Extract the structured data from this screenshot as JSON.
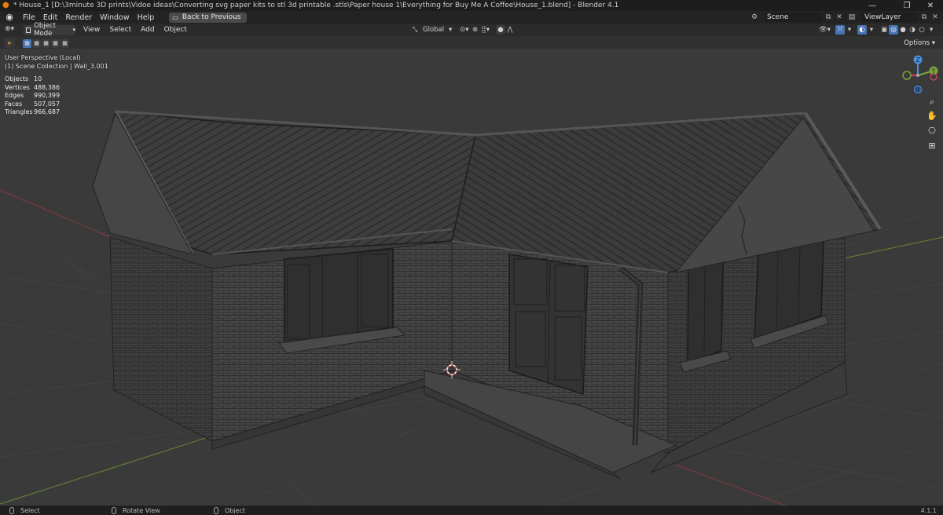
{
  "window": {
    "title": "* House_1 [D:\\3minute 3D prints\\Vidoe ideas\\Converting svg paper kits to stl 3d printable .stls\\Paper house 1\\Everything for Buy Me A Coffee\\House_1.blend] - Blender 4.1",
    "controls": {
      "minimize": "—",
      "maximize": "❐",
      "close": "✕"
    }
  },
  "menubar": {
    "items": [
      "File",
      "Edit",
      "Render",
      "Window",
      "Help"
    ],
    "back_button": "Back to Previous",
    "scene_label": "Scene",
    "view_layer_label": "ViewLayer"
  },
  "viewport_header": {
    "mode": "Object Mode",
    "menus": [
      "View",
      "Select",
      "Add",
      "Object"
    ],
    "transform_orientation": "Global",
    "options_label": "Options"
  },
  "viewport_overlay": {
    "perspective": "User Perspective (Local)",
    "collection": "(1) Scene Collection | Wall_3.001",
    "stats": [
      {
        "label": "Objects",
        "value": "10"
      },
      {
        "label": "Vertices",
        "value": "488,386"
      },
      {
        "label": "Edges",
        "value": "990,399"
      },
      {
        "label": "Faces",
        "value": "507,057"
      },
      {
        "label": "Triangles",
        "value": "966,687"
      }
    ]
  },
  "gizmo": {
    "z_label": "Z",
    "y_label": "Y"
  },
  "nav_icons": [
    "zoom-icon",
    "hand-pan-icon",
    "camera-icon",
    "grid-ortho-icon"
  ],
  "statusbar": {
    "items": [
      "Select",
      "Rotate View",
      "Object"
    ],
    "version": "4.1.1"
  },
  "colors": {
    "accent_blue": "#4772b3",
    "x_axis": "#c5434c",
    "y_axis": "#7aa33a",
    "z_axis": "#4a8fe0",
    "roof": "#3a3a3a",
    "wall": "#414141"
  }
}
